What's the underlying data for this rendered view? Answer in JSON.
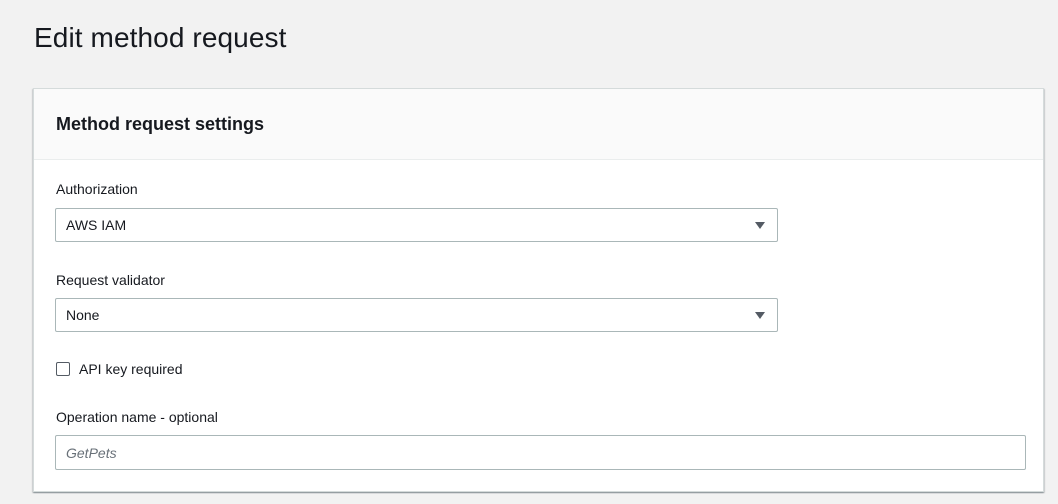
{
  "page": {
    "title": "Edit method request"
  },
  "panel": {
    "header": "Method request settings",
    "authorization": {
      "label": "Authorization",
      "value": "AWS IAM",
      "icon": "caret-down-icon"
    },
    "request_validator": {
      "label": "Request validator",
      "value": "None",
      "icon": "caret-down-icon"
    },
    "api_key": {
      "label": "API key required",
      "checked": false
    },
    "operation_name": {
      "label": "Operation name - optional",
      "value": "",
      "placeholder": "GetPets"
    }
  },
  "colors": {
    "page_background": "#f2f2f2",
    "panel_background": "#ffffff",
    "panel_header_background": "#fafafa",
    "input_border": "#aab7b8",
    "text": "#16191f",
    "placeholder": "#687078"
  }
}
